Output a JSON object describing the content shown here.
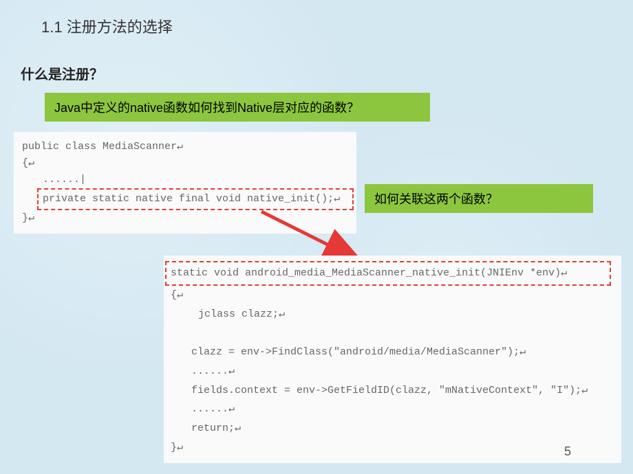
{
  "section_title": "1.1 注册方法的选择",
  "sub_title": "什么是注册？",
  "green_box_1": "Java中定义的native函数如何找到Native层对应的函数？",
  "green_box_2": "如何关联这两个函数？",
  "code1": {
    "line1": "public class MediaScanner↵",
    "line2": "{↵",
    "line3": "......|",
    "line4": "private static native final void native_init();↵",
    "line5": "}↵"
  },
  "code2": {
    "line1": "static void  android_media_MediaScanner_native_init(JNIEnv *env)↵",
    "line2": "{↵",
    "line3": "jclass clazz;↵",
    "line4_spacer": "",
    "line5": "clazz = env->FindClass(\"android/media/MediaScanner\");↵",
    "line6": "......↵",
    "line7": "fields.context = env->GetFieldID(clazz, \"mNativeContext\", \"I\");↵",
    "line8": "......↵",
    "line9": "return;↵",
    "line10": "}↵"
  },
  "page_number": "5"
}
